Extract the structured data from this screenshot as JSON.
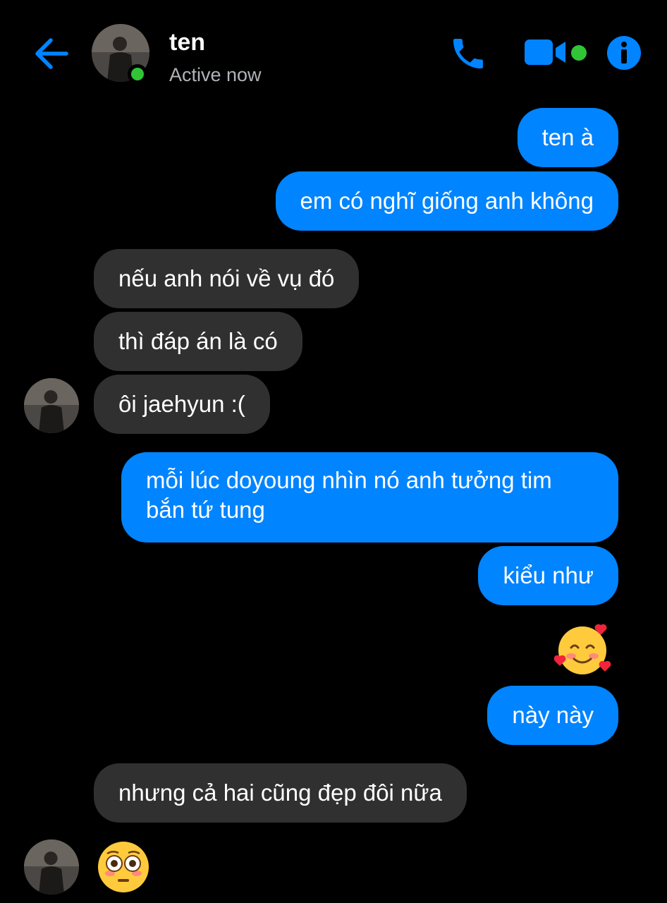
{
  "header": {
    "contact_name": "ten",
    "status": "Active now",
    "colors": {
      "accent": "#0084ff",
      "online": "#31c437"
    }
  },
  "messages": [
    {
      "direction": "out",
      "text": "ten à"
    },
    {
      "direction": "out",
      "text": "em có nghĩ giống anh không"
    },
    {
      "direction": "in",
      "text": "nếu anh nói về vụ đó"
    },
    {
      "direction": "in",
      "text": "thì đáp án là có"
    },
    {
      "direction": "in",
      "text": "ôi jaehyun :("
    },
    {
      "direction": "out",
      "text": "mỗi lúc doyoung nhìn nó anh tưởng tim bắn tứ tung"
    },
    {
      "direction": "out",
      "text": "kiểu như"
    },
    {
      "direction": "out",
      "emoji": "smiling-face-with-hearts"
    },
    {
      "direction": "out",
      "text": "này này"
    },
    {
      "direction": "in",
      "text": "nhưng cả hai cũng đẹp đôi nữa"
    },
    {
      "direction": "in",
      "emoji": "flushed-face"
    }
  ],
  "icons": [
    "back-arrow-icon",
    "phone-icon",
    "video-camera-icon",
    "info-icon"
  ]
}
